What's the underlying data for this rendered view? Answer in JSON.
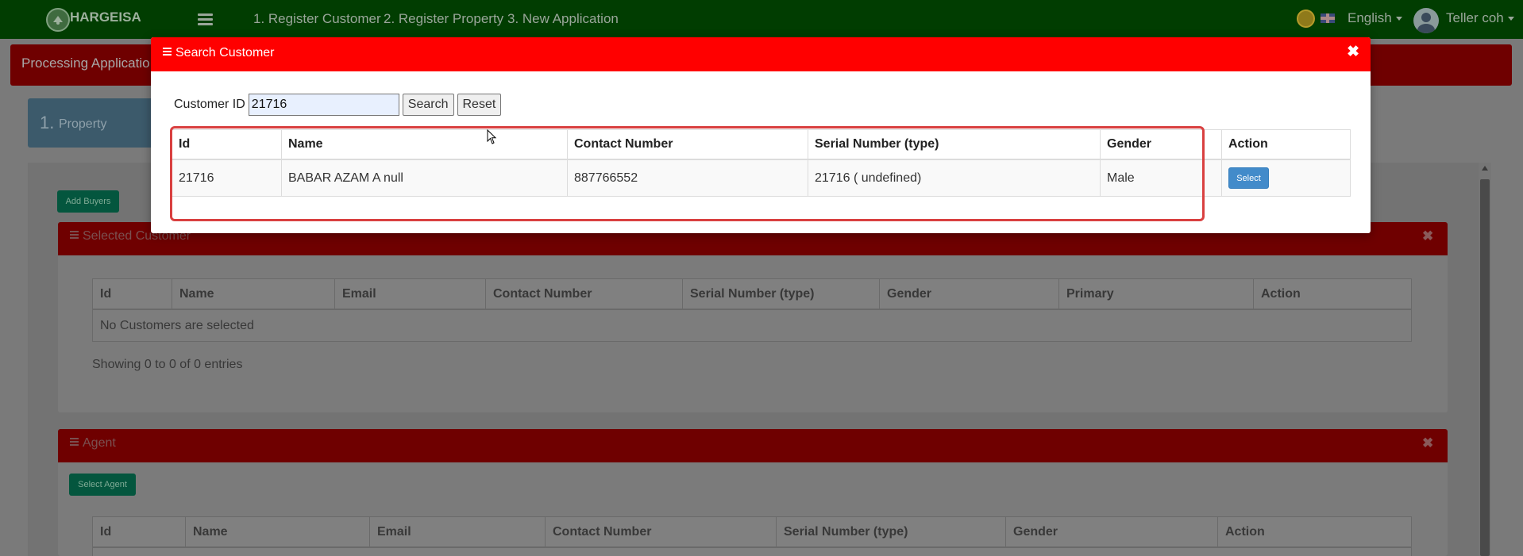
{
  "navbar": {
    "logo_title": "HARGEISA",
    "links": [
      "1. Register Customer",
      "2. Register Property",
      "3. New Application"
    ],
    "language": "English",
    "user": "Teller coh"
  },
  "page": {
    "title": "Processing Applicatio",
    "step_number": "1.",
    "step_label": "Property",
    "add_buyers_label": "Add Buyers",
    "select_agent_label": "Select Agent"
  },
  "selected_customer": {
    "title": "Selected Customer",
    "columns": [
      "Id",
      "Name",
      "Email",
      "Contact Number",
      "Serial Number (type)",
      "Gender",
      "Primary",
      "Action"
    ],
    "empty_text": "No Customers are selected",
    "showing_text": "Showing 0 to 0 of 0 entries"
  },
  "agent": {
    "title": "Agent",
    "columns": [
      "Id",
      "Name",
      "Email",
      "Contact Number",
      "Serial Number (type)",
      "Gender",
      "Action"
    ]
  },
  "modal": {
    "title": "Search Customer",
    "search_label": "Customer ID",
    "search_value": "21716",
    "search_button": "Search",
    "reset_button": "Reset",
    "columns": [
      "Id",
      "Name",
      "Contact Number",
      "Serial Number (type)",
      "Gender",
      "Action"
    ],
    "rows": [
      {
        "id": "21716",
        "name": "BABAR AZAM A null",
        "contact": "887766552",
        "serial": "21716 ( undefined)",
        "gender": "Male",
        "action": "Select"
      }
    ]
  },
  "colors": {
    "navbar": "#013d01",
    "modal_header": "#ff0000",
    "select_button": "#428bca",
    "highlight": "#d94040"
  }
}
